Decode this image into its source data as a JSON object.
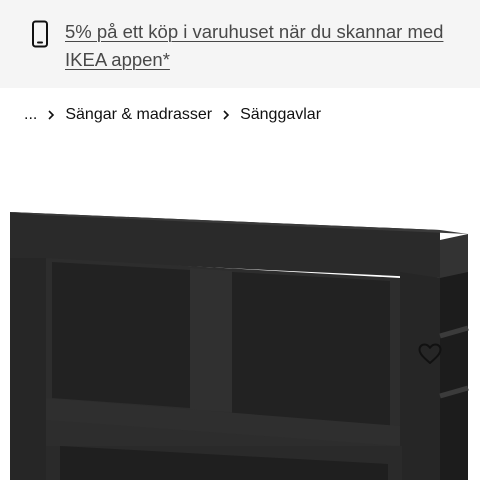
{
  "promo": {
    "icon": "phone-icon",
    "text": "5% på ett köp i varuhuset när du skannar med IKEA appen*"
  },
  "breadcrumb": {
    "items": [
      "...",
      "Sängar & madrasser",
      "Sänggavlar"
    ],
    "separator_icon": "chevron-right-icon"
  },
  "product": {
    "favorite_icon": "heart-icon",
    "image_subject": "headboard-with-shelves"
  },
  "colors": {
    "banner_bg": "#f5f5f5",
    "text": "#111111",
    "promo_text": "#484848",
    "product_dark": "#2c2c2c"
  }
}
